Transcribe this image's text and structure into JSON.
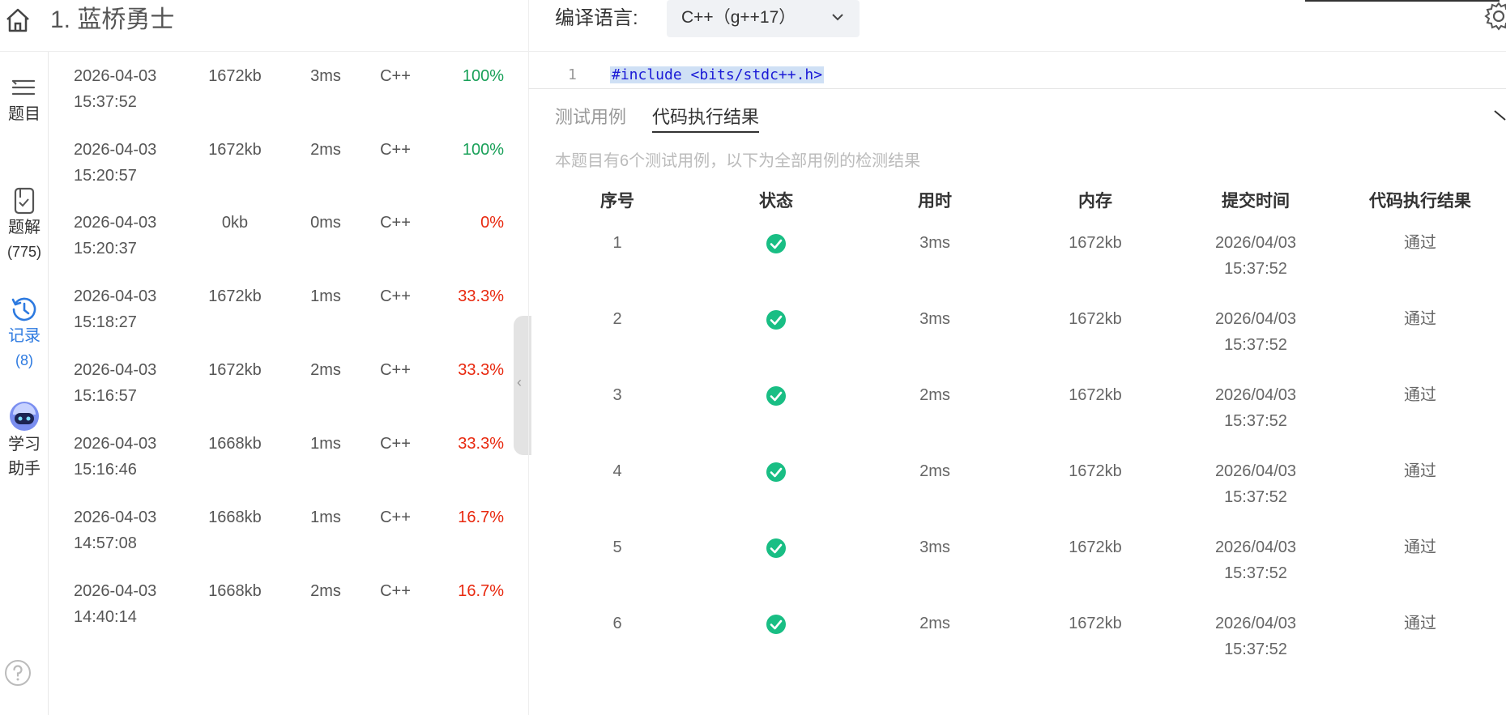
{
  "header": {
    "title": "1. 蓝桥勇士"
  },
  "rail": {
    "items": [
      {
        "label": "题目",
        "count": ""
      },
      {
        "label": "题解",
        "count": "(775)"
      },
      {
        "label": "记录",
        "count": "(8)"
      },
      {
        "label": "学习",
        "label2": "助手"
      }
    ]
  },
  "submissions": [
    {
      "date": "2026-04-03",
      "time": "15:37:52",
      "memory": "1672kb",
      "duration": "3ms",
      "lang": "C++",
      "score": "100%",
      "status": "pass"
    },
    {
      "date": "2026-04-03",
      "time": "15:20:57",
      "memory": "1672kb",
      "duration": "2ms",
      "lang": "C++",
      "score": "100%",
      "status": "pass"
    },
    {
      "date": "2026-04-03",
      "time": "15:20:37",
      "memory": "0kb",
      "duration": "0ms",
      "lang": "C++",
      "score": "0%",
      "status": "fail"
    },
    {
      "date": "2026-04-03",
      "time": "15:18:27",
      "memory": "1672kb",
      "duration": "1ms",
      "lang": "C++",
      "score": "33.3%",
      "status": "fail"
    },
    {
      "date": "2026-04-03",
      "time": "15:16:57",
      "memory": "1672kb",
      "duration": "2ms",
      "lang": "C++",
      "score": "33.3%",
      "status": "fail"
    },
    {
      "date": "2026-04-03",
      "time": "15:16:46",
      "memory": "1668kb",
      "duration": "1ms",
      "lang": "C++",
      "score": "33.3%",
      "status": "fail"
    },
    {
      "date": "2026-04-03",
      "time": "14:57:08",
      "memory": "1668kb",
      "duration": "1ms",
      "lang": "C++",
      "score": "16.7%",
      "status": "fail"
    },
    {
      "date": "2026-04-03",
      "time": "14:40:14",
      "memory": "1668kb",
      "duration": "2ms",
      "lang": "C++",
      "score": "16.7%",
      "status": "fail"
    }
  ],
  "editor": {
    "lang_label": "编译语言:",
    "lang_value": "C++（g++17）",
    "line_number": "1",
    "code_line": "#include <bits/stdc++.h>"
  },
  "results": {
    "tab_testcase": "测试用例",
    "tab_result": "代码执行结果",
    "description": "本题目有6个测试用例，以下为全部用例的检测结果",
    "headers": [
      "序号",
      "状态",
      "用时",
      "内存",
      "提交时间",
      "代码执行结果"
    ],
    "rows": [
      {
        "id": "1",
        "duration": "3ms",
        "memory": "1672kb",
        "date": "2026/04/03",
        "time": "15:37:52",
        "result": "通过"
      },
      {
        "id": "2",
        "duration": "3ms",
        "memory": "1672kb",
        "date": "2026/04/03",
        "time": "15:37:52",
        "result": "通过"
      },
      {
        "id": "3",
        "duration": "2ms",
        "memory": "1672kb",
        "date": "2026/04/03",
        "time": "15:37:52",
        "result": "通过"
      },
      {
        "id": "4",
        "duration": "2ms",
        "memory": "1672kb",
        "date": "2026/04/03",
        "time": "15:37:52",
        "result": "通过"
      },
      {
        "id": "5",
        "duration": "3ms",
        "memory": "1672kb",
        "date": "2026/04/03",
        "time": "15:37:52",
        "result": "通过"
      },
      {
        "id": "6",
        "duration": "2ms",
        "memory": "1672kb",
        "date": "2026/04/03",
        "time": "15:37:52",
        "result": "通过"
      }
    ]
  },
  "colors": {
    "pass": "#18a058",
    "fail": "#e8280e",
    "ok_icon": "#19be84",
    "active": "#2d7ae0"
  }
}
